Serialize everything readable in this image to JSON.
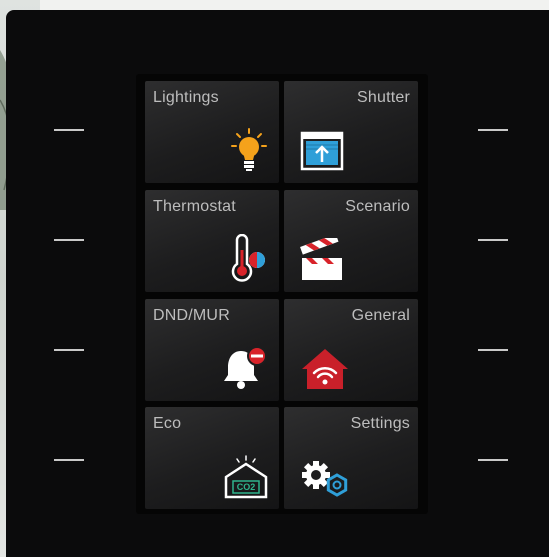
{
  "tiles": [
    {
      "label": "Lightings",
      "icon": "light-bulb-icon",
      "color": "#f5a21b"
    },
    {
      "label": "Shutter",
      "icon": "shutter-icon",
      "color": "#2f9fd8"
    },
    {
      "label": "Thermostat",
      "icon": "thermometer-icon",
      "color": "#ffffff"
    },
    {
      "label": "Scenario",
      "icon": "clapperboard-icon",
      "color": "#d8232a"
    },
    {
      "label": "DND/MUR",
      "icon": "bell-dnd-icon",
      "color": "#d8232a"
    },
    {
      "label": "General",
      "icon": "home-wifi-icon",
      "color": "#c9202a"
    },
    {
      "label": "Eco",
      "icon": "co2-house-icon",
      "color": "#2fb48c"
    },
    {
      "label": "Settings",
      "icon": "gears-icon",
      "color": "#2f9fd8"
    }
  ],
  "eco_icon_text": "CO2"
}
